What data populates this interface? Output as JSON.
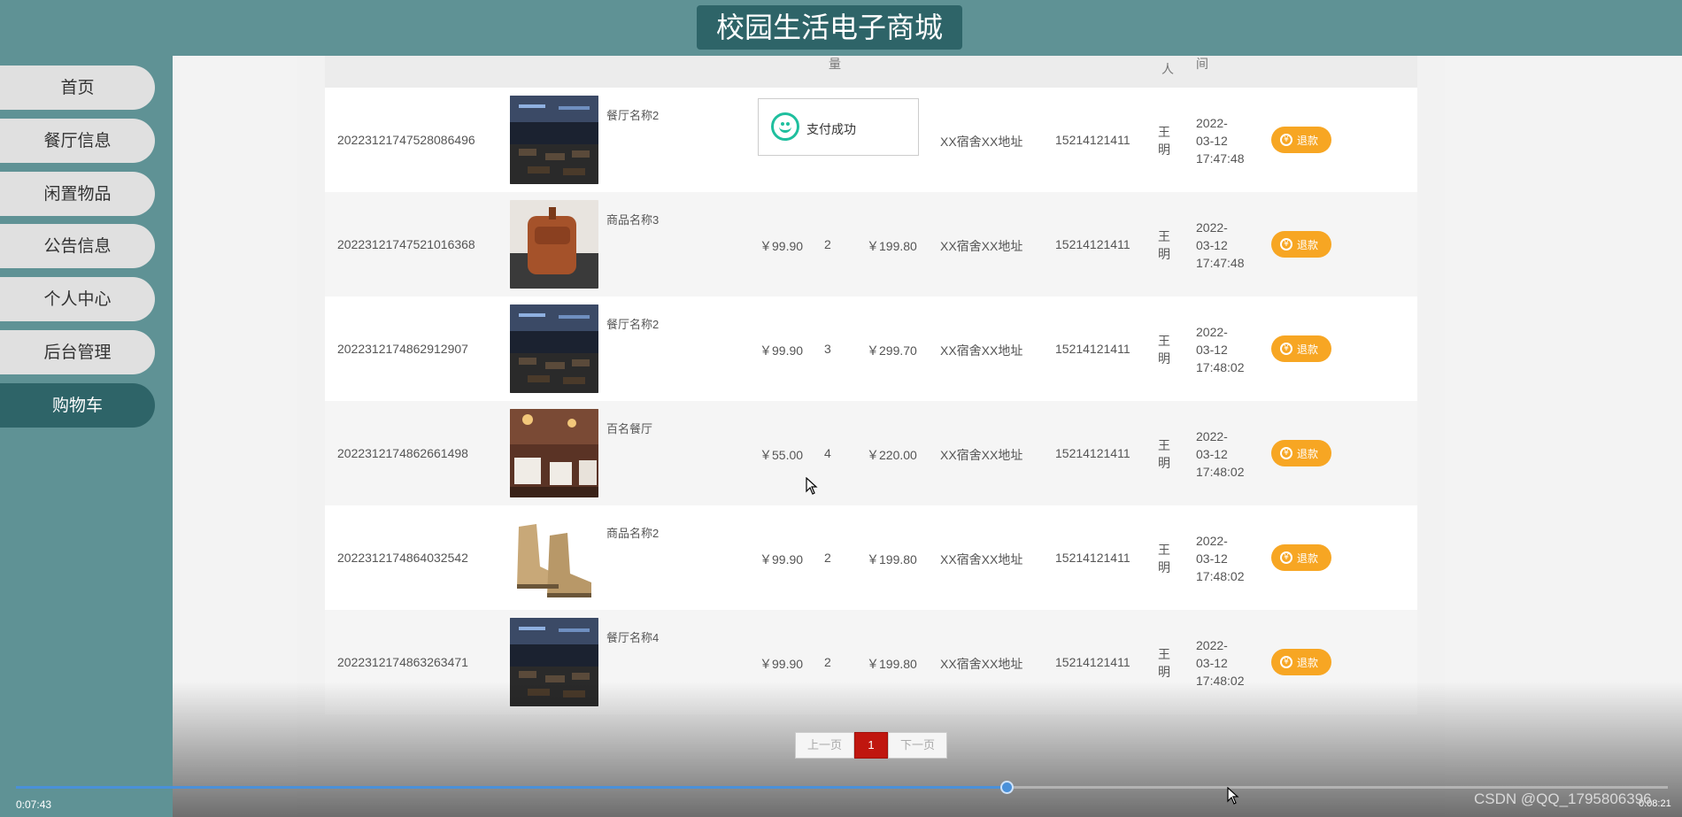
{
  "header": {
    "title": "校园生活电子商城"
  },
  "sidebar": {
    "items": [
      {
        "label": "首页",
        "active": false
      },
      {
        "label": "餐厅信息",
        "active": false
      },
      {
        "label": "闲置物品",
        "active": false
      },
      {
        "label": "公告信息",
        "active": false
      },
      {
        "label": "个人中心",
        "active": false
      },
      {
        "label": "后台管理",
        "active": false
      },
      {
        "label": "购物车",
        "active": true
      }
    ]
  },
  "table": {
    "visible_header_fragments": [
      "量",
      "人",
      "间"
    ],
    "rows": [
      {
        "order_no": "20223121747528086496",
        "product": "餐厅名称2",
        "image": "restaurant-photo",
        "status_popup": "支付成功",
        "address": "XX宿舍XX地址",
        "phone": "15214121411",
        "receiver": "王明",
        "time_date": "2022-",
        "time_md": "03-12",
        "time_hms": "17:47:48",
        "action": "退款"
      },
      {
        "order_no": "20223121747521016368",
        "product": "商品名称3",
        "image": "leather-bag-photo",
        "price": "￥99.90",
        "qty": "2",
        "total": "￥199.80",
        "address": "XX宿舍XX地址",
        "phone": "15214121411",
        "receiver": "王明",
        "time_date": "2022-",
        "time_md": "03-12",
        "time_hms": "17:47:48",
        "action": "退款"
      },
      {
        "order_no": "2022312174862912907",
        "product": "餐厅名称2",
        "image": "restaurant-photo",
        "price": "￥99.90",
        "qty": "3",
        "total": "￥299.70",
        "address": "XX宿舍XX地址",
        "phone": "15214121411",
        "receiver": "王明",
        "time_date": "2022-",
        "time_md": "03-12",
        "time_hms": "17:48:02",
        "action": "退款"
      },
      {
        "order_no": "2022312174862661498",
        "product": "百名餐厅",
        "image": "dining-room-photo",
        "price": "￥55.00",
        "qty": "4",
        "total": "￥220.00",
        "address": "XX宿舍XX地址",
        "phone": "15214121411",
        "receiver": "王明",
        "time_date": "2022-",
        "time_md": "03-12",
        "time_hms": "17:48:02",
        "action": "退款"
      },
      {
        "order_no": "2022312174864032542",
        "product": "商品名称2",
        "image": "boots-photo",
        "price": "￥99.90",
        "qty": "2",
        "total": "￥199.80",
        "address": "XX宿舍XX地址",
        "phone": "15214121411",
        "receiver": "王明",
        "time_date": "2022-",
        "time_md": "03-12",
        "time_hms": "17:48:02",
        "action": "退款"
      },
      {
        "order_no": "2022312174863263471",
        "product": "餐厅名称4",
        "image": "restaurant-photo",
        "price": "￥99.90",
        "qty": "2",
        "total": "￥199.80",
        "address": "XX宿舍XX地址",
        "phone": "15214121411",
        "receiver": "王明",
        "time_date": "2022-",
        "time_md": "03-12",
        "time_hms": "17:48:02",
        "action": "退款"
      }
    ]
  },
  "pagination": {
    "prev": "上一页",
    "current": "1",
    "next": "下一页"
  },
  "video": {
    "current_time": "0:07:43",
    "total_time": "0:08:21",
    "progress_fraction": 0.6,
    "watermark": "CSDN @QQ_1795806396"
  },
  "colors": {
    "header_bg": "#5f9295",
    "title_bg": "#2e6468",
    "refund_btn": "#f7a623",
    "page_active": "#c0160f",
    "progress": "#4a90d9"
  }
}
